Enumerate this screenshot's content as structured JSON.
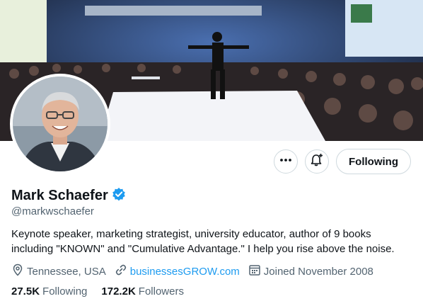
{
  "profile": {
    "display_name": "Mark Schaefer",
    "handle": "@markwschaefer",
    "verified": true,
    "bio": "Keynote speaker, marketing strategist, university educator, author of 9 books including \"KNOWN\" and \"Cumulative Advantage.\" I help you rise above the noise.",
    "location": "Tennessee, USA",
    "website": "businessesGROW.com",
    "joined": "Joined November 2008"
  },
  "actions": {
    "more_icon": "more-horizontal-icon",
    "notify_icon": "bell-plus-icon",
    "follow_label": "Following"
  },
  "stats": {
    "following_count": "27.5K",
    "following_label": "Following",
    "followers_count": "172.2K",
    "followers_label": "Followers"
  },
  "colors": {
    "accent": "#1d9bf0",
    "text": "#0f1419",
    "secondary_text": "#536471",
    "border": "#cfd9de"
  }
}
